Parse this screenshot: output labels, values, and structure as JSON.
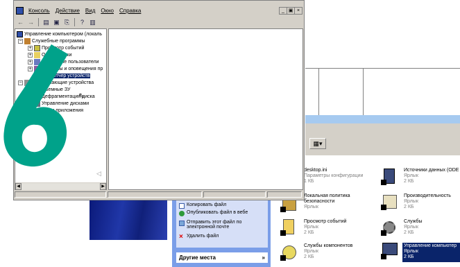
{
  "window": {
    "menu": [
      "Консоль",
      "Действие",
      "Вид",
      "Окно",
      "Справка"
    ],
    "window_controls": [
      "_",
      "×"
    ],
    "window_controls_restore": "▣"
  },
  "tree": {
    "root": "Управление компьютером (локаль",
    "system_tools": "Служебные программы",
    "event_viewer": "Просмотр событий",
    "shared_folders": "Общие папки",
    "local_users": "Локальные пользователи",
    "perf_logs": "Журналы и оповещения пр",
    "device_manager": "Диспетчер устройств",
    "storage": "Запоминающие устройства",
    "removable": "Съемные ЗУ",
    "defrag": "Дефрагментация диска",
    "disk_mgmt": "Управление дисками",
    "services_apps": "Службы и приложения"
  },
  "tasks": {
    "copy": "Копировать файл",
    "publish": "Опубликовать файл в вебе",
    "email": "Отправить этот файл по электронной почте",
    "delete": "Удалить файл",
    "other_places": "Другие места",
    "chevron": "»"
  },
  "files": [
    {
      "name": "desktop.ini",
      "sub1": "Параметры конфигурации",
      "sub2": "1 КБ"
    },
    {
      "name": "Источники данных (ODE",
      "sub1": "Ярлык",
      "sub2": "2 КБ"
    },
    {
      "name": "Локальная политика",
      "name2": "безопасности",
      "sub1": "Ярлык"
    },
    {
      "name": "Производительность",
      "sub1": "Ярлык",
      "sub2": "2 КБ"
    },
    {
      "name": "Просмотр событий",
      "sub1": "Ярлык",
      "sub2": "2 КБ"
    },
    {
      "name": "Службы",
      "sub1": "Ярлык",
      "sub2": "2 КБ"
    },
    {
      "name": "Службы компонентов",
      "sub1": "Ярлык",
      "sub2": "2 КБ"
    },
    {
      "name": "Управление компьютер",
      "sub1": "Ярлык",
      "sub2": "2 КБ"
    }
  ],
  "colors": {
    "accent": "#00a28a",
    "selection": "#0a246a"
  }
}
